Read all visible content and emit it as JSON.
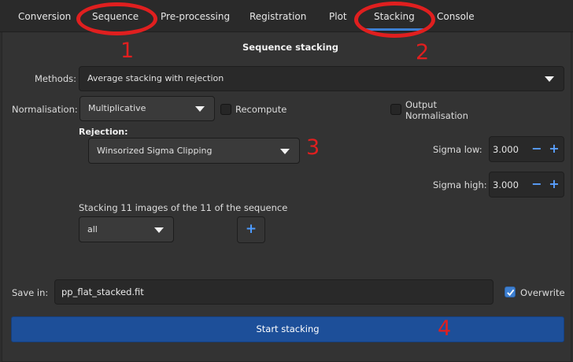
{
  "tabs": [
    {
      "label": "Conversion",
      "active": false
    },
    {
      "label": "Sequence",
      "active": false
    },
    {
      "label": "Pre-processing",
      "active": false
    },
    {
      "label": "Registration",
      "active": false
    },
    {
      "label": "Plot",
      "active": false
    },
    {
      "label": "Stacking",
      "active": true
    },
    {
      "label": "Console",
      "active": false
    }
  ],
  "panel": {
    "title": "Sequence stacking",
    "methods_label": "Methods:",
    "methods_value": "Average stacking with rejection",
    "normalisation_label": "Normalisation:",
    "normalisation_value": "Multiplicative",
    "recompute_label": "Recompute",
    "recompute_checked": false,
    "output_normalisation_label_1": "Output",
    "output_normalisation_label_2": "Normalisation",
    "output_normalisation_checked": false,
    "rejection_label": "Rejection:",
    "rejection_value": "Winsorized Sigma Clipping",
    "sigma_low_label": "Sigma low:",
    "sigma_low_value": "3.000",
    "sigma_high_label": "Sigma high:",
    "sigma_high_value": "3.000",
    "stacking_info": "Stacking 11 images of the 11 of the sequence",
    "filter_value": "all",
    "save_label": "Save in:",
    "save_value": "pp_flat_stacked.fit",
    "overwrite_label": "Overwrite",
    "overwrite_checked": true,
    "start_button": "Start stacking"
  },
  "annotations": [
    "1",
    "2",
    "3",
    "4"
  ],
  "colors": {
    "accent": "#3d7fd1",
    "button_primary": "#1d4f99",
    "annotation": "#e01f1f",
    "background": "#333333"
  },
  "icons": [
    "dropdown-arrow-icon",
    "minus-icon",
    "plus-icon",
    "checkmark-icon"
  ]
}
